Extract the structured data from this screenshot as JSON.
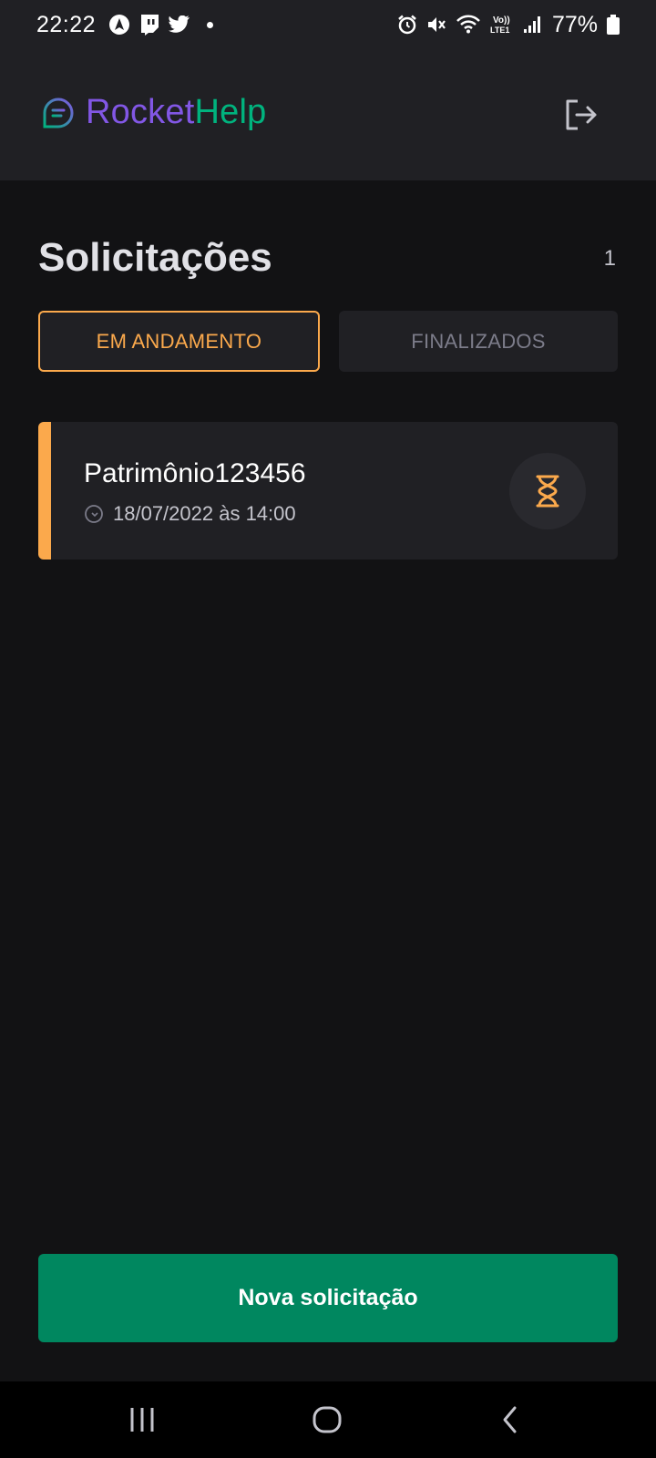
{
  "status_bar": {
    "time": "22:22",
    "battery": "77%",
    "left_icons": [
      "navigation-app-icon",
      "twitch-icon",
      "twitter-icon",
      "notification-dot"
    ],
    "right_icons": [
      "alarm-icon",
      "mute-icon",
      "wifi-icon",
      "volte-icon",
      "signal-icon",
      "battery-icon"
    ]
  },
  "header": {
    "logo_part1": "Rocket",
    "logo_part2": "Help",
    "logo_icon": "chat-bubble-icon",
    "logout_icon": "logout-icon"
  },
  "main": {
    "title": "Solicitações",
    "count": "1",
    "tabs": [
      {
        "label": "EM ANDAMENTO",
        "active": true
      },
      {
        "label": "FINALIZADOS",
        "active": false
      }
    ],
    "requests": [
      {
        "patrimony": "Patrimônio123456",
        "datetime": "18/07/2022 às 14:00",
        "status": "open",
        "status_icon": "hourglass-icon"
      }
    ],
    "new_request_label": "Nova solicitação"
  },
  "colors": {
    "background": "#121214",
    "surface": "#202024",
    "accent_open": "#fba94c",
    "brand_purple": "#8257e5",
    "brand_green": "#00b37e",
    "button_green": "#00875f",
    "muted_text": "#7c7c8a"
  },
  "nav_bar": {
    "buttons": [
      "recent-apps",
      "home",
      "back"
    ]
  }
}
